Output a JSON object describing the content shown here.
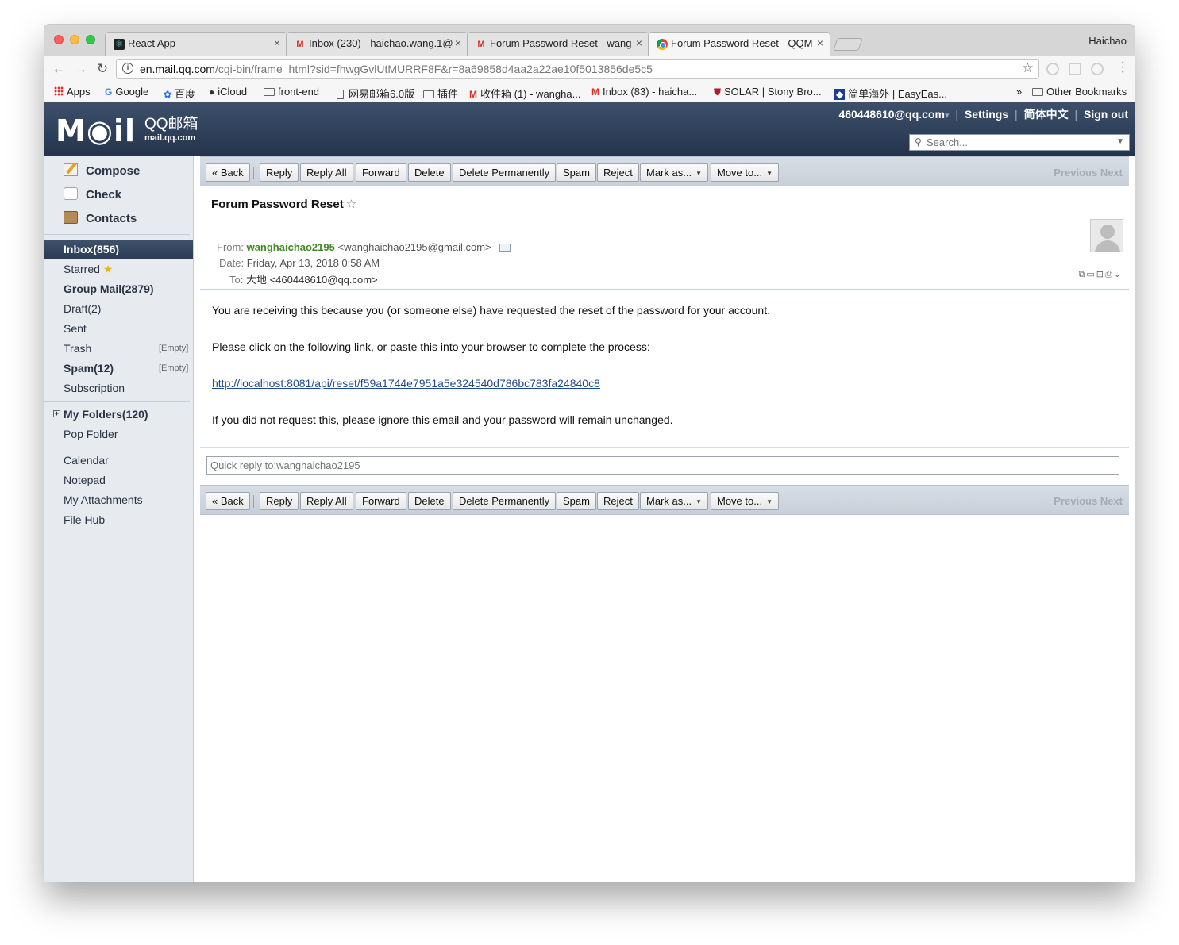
{
  "browser": {
    "tabs": [
      {
        "title": "React App",
        "favicon": "react-icon"
      },
      {
        "title": "Inbox (230) - haichao.wang.1@",
        "favicon": "gmail-icon"
      },
      {
        "title": "Forum Password Reset - wang",
        "favicon": "gmail-icon"
      },
      {
        "title": "Forum Password Reset - QQM",
        "favicon": "chrome-icon"
      }
    ],
    "profile_name": "Haichao",
    "url_host": "en.mail.qq.com",
    "url_path": "/cgi-bin/frame_html?sid=fhwgGvlUtMURRF8F&r=8a69858d4aa2a22ae10f5013856de5c5",
    "bookmarks": [
      "Apps",
      "Google",
      "百度",
      "iCloud",
      "front-end",
      "网易邮箱6.0版",
      "插件",
      "收件箱 (1) - wangha...",
      "Inbox (83) - haicha...",
      "SOLAR | Stony Bro...",
      "简单海外 | EasyEas..."
    ],
    "bookmarks_overflow": "»",
    "other_bookmarks": "Other Bookmarks"
  },
  "mail_header": {
    "logo_text": "M◉il",
    "logo_brand": "QQ邮箱",
    "logo_domain": "mail.qq.com",
    "account": "460448610@qq.com",
    "account_arrow": "▾",
    "settings": "Settings",
    "language": "简体中文",
    "sign_out": "Sign out",
    "search_placeholder": "Search..."
  },
  "sidebar": {
    "compose": "Compose",
    "check": "Check",
    "contacts": "Contacts",
    "inbox": "Inbox(856)",
    "starred": "Starred",
    "group_mail": "Group Mail(2879)",
    "draft": "Draft(2)",
    "sent": "Sent",
    "trash": "Trash",
    "trash_empty": "[Empty]",
    "spam": "Spam(12)",
    "spam_empty": "[Empty]",
    "subscription": "Subscription",
    "my_folders": "My Folders(120)",
    "pop_folder": "Pop Folder",
    "calendar": "Calendar",
    "notepad": "Notepad",
    "my_attachments": "My Attachments",
    "file_hub": "File Hub"
  },
  "actions": {
    "back": "« Back",
    "reply": "Reply",
    "reply_all": "Reply All",
    "forward": "Forward",
    "delete": "Delete",
    "delete_permanently": "Delete Permanently",
    "spam": "Spam",
    "reject": "Reject",
    "mark_as": "Mark as...",
    "move_to": "Move to...",
    "previous": "Previous",
    "next": "Next"
  },
  "email": {
    "subject": "Forum Password Reset",
    "from_label": "From:",
    "from_name": "wanghaichao2195",
    "from_address": "<wanghaichao2195@gmail.com>",
    "date_label": "Date:",
    "date": "Friday, Apr 13, 2018 0:58 AM",
    "to_label": "To:",
    "to": "大地 <460448610@qq.com>",
    "body": [
      "You are receiving this because you (or someone else) have requested the reset of the password for your account.",
      "Please click on the following link, or paste this into your browser to complete the process:",
      "http://localhost:8081/api/reset/f59a1744e7951a5e324540d786bc783fa24840c8",
      "If you did not request this, please ignore this email and your password will remain unchanged."
    ],
    "quick_reply_placeholder": "Quick reply to:wanghaichao2195"
  },
  "colors": {
    "header_bg": "#2c3c55",
    "sidebar_bg": "#e7ebef",
    "sender_green": "#3f8a22",
    "link_blue": "#1e4b8f"
  }
}
